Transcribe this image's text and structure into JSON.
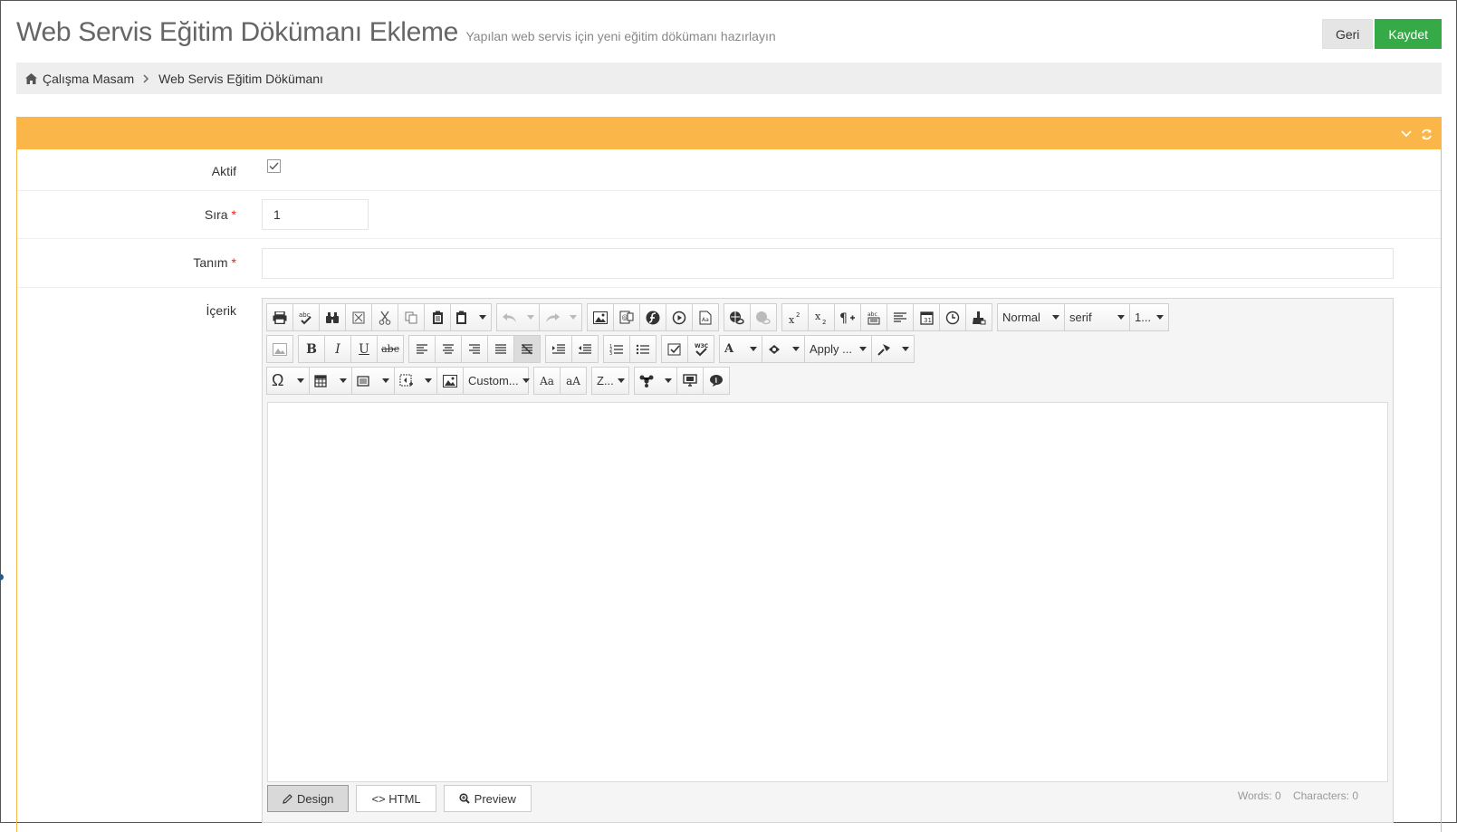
{
  "header": {
    "title": "Web Servis Eğitim Dökümanı Ekleme",
    "subtitle": "Yapılan web servis için yeni eğitim dökümanı hazırlayın",
    "back_label": "Geri",
    "save_label": "Kaydet"
  },
  "breadcrumb": {
    "home_label": "Çalışma Masam",
    "current_label": "Web Servis Eğitim Dökümanı"
  },
  "form": {
    "active": {
      "label": "Aktif",
      "checked": true
    },
    "order": {
      "label": "Sıra",
      "required_mark": "*",
      "value": "1"
    },
    "definition": {
      "label": "Tanım",
      "required_mark": "*",
      "value": ""
    },
    "content": {
      "label": "İçerik"
    }
  },
  "editor": {
    "paragraph_style": "Normal",
    "font_family": "serif",
    "font_size": "1...",
    "css_class": "Apply ...",
    "custom_links": "Custom...",
    "zoom": "Z...",
    "case_upper": "Aa",
    "case_lower": "aA",
    "mode_design": "Design",
    "mode_html": "<> HTML",
    "mode_preview": "Preview",
    "words_label": "Words: 0",
    "chars_label": "Characters: 0"
  },
  "colors": {
    "accent_orange": "#fbb64a",
    "save_green": "#35aa47",
    "required_red": "#e02222",
    "breadcrumb_bg": "#eeeeee"
  }
}
